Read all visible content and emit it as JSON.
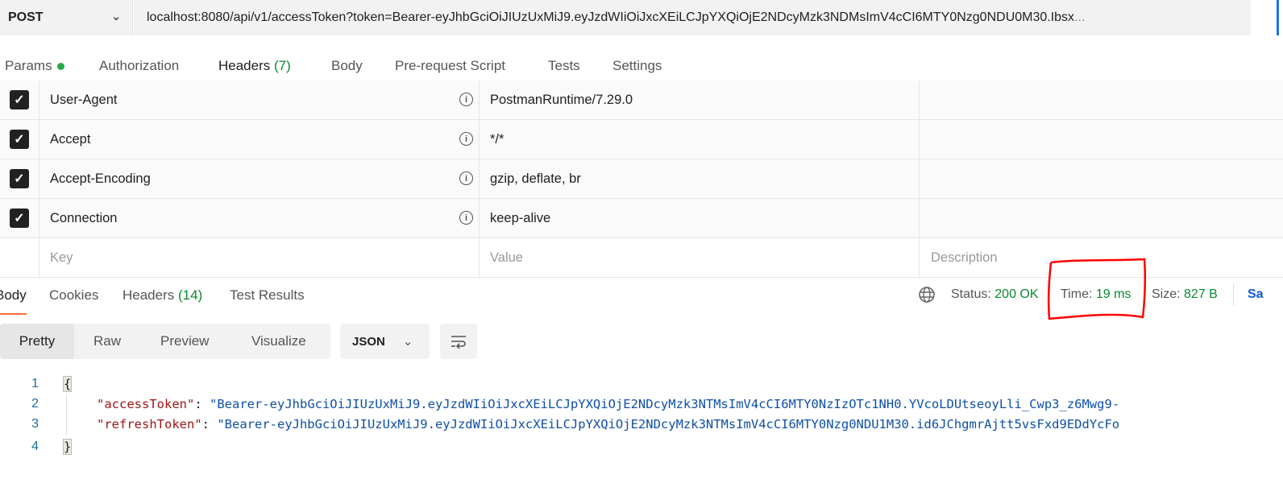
{
  "request": {
    "method": "POST",
    "url": "localhost:8080/api/v1/accessToken?token=Bearer-eyJhbGciOiJIUzUxMiJ9.eyJzdWIiOiJxcXEiLCJpYXQiOjE2NDcyMzk3NDMsImV4cCI6MTY0Nzg0NDU0M30.Ibsx",
    "url_ellipsis": "..."
  },
  "tabs": {
    "params": "Params",
    "authorization": "Authorization",
    "headers": "Headers",
    "headers_count": "(7)",
    "body": "Body",
    "prerequest": "Pre-request Script",
    "tests": "Tests",
    "settings": "Settings"
  },
  "headers": [
    {
      "key": "User-Agent",
      "value": "PostmanRuntime/7.29.0",
      "checked": true
    },
    {
      "key": "Accept",
      "value": "*/*",
      "checked": true
    },
    {
      "key": "Accept-Encoding",
      "value": "gzip, deflate, br",
      "checked": true
    },
    {
      "key": "Connection",
      "value": "keep-alive",
      "checked": true
    }
  ],
  "placeholders": {
    "key": "Key",
    "value": "Value",
    "description": "Description"
  },
  "response": {
    "tabs": {
      "body": "Body",
      "cookies": "Cookies",
      "headers": "Headers",
      "headers_count": "(14)",
      "test_results": "Test Results"
    },
    "status_label": "Status:",
    "status": "200 OK",
    "time_label": "Time:",
    "time": "19 ms",
    "size_label": "Size:",
    "size": "827 B",
    "save": "Sa",
    "views": {
      "pretty": "Pretty",
      "raw": "Raw",
      "preview": "Preview",
      "visualize": "Visualize"
    },
    "format": "JSON",
    "lines": [
      "1",
      "2",
      "3",
      "4"
    ],
    "open_brace": "{",
    "close_brace": "}",
    "access_key": "\"accessToken\"",
    "access_value": "\"Bearer-eyJhbGciOiJIUzUxMiJ9.eyJzdWIiOiJxcXEiLCJpYXQiOjE2NDcyMzk3NTMsImV4cCI6MTY0NzIzOTc1NH0.YVcoLDUtseoyLli_Cwp3_z6Mwg9-",
    "refresh_key": "\"refreshToken\"",
    "refresh_value": "\"Bearer-eyJhbGciOiJIUzUxMiJ9.eyJzdWIiOiJxcXEiLCJpYXQiOjE2NDcyMzk3NTMsImV4cCI6MTY0Nzg0NDU1M30.id6JChgmrAjtt5vsFxd9EDdYcFo",
    "colon": ": "
  },
  "colors": {
    "accent": "#ff6c37",
    "success": "#0a8a2e",
    "annotation": "#ff0000"
  }
}
